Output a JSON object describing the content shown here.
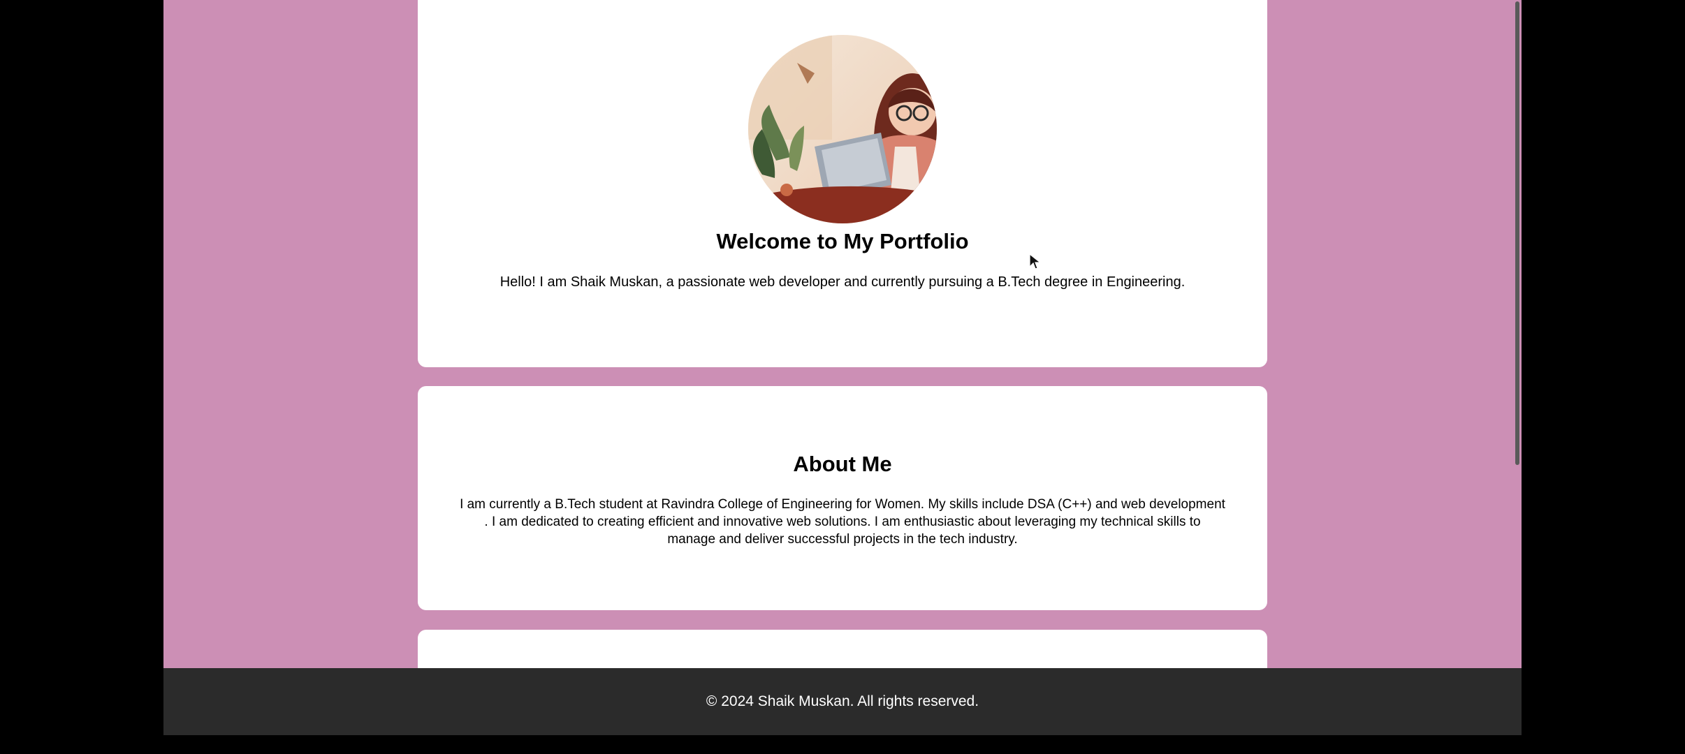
{
  "hero": {
    "title": "Welcome to My Portfolio",
    "intro": "Hello! I am Shaik Muskan, a passionate web developer and currently pursuing a B.Tech degree in Engineering.",
    "avatar_icon": "avatar-illustration"
  },
  "about": {
    "title": "About Me",
    "text": "I am currently a B.Tech student at Ravindra College of Engineering for Women. My skills include DSA (C++) and web development . I am dedicated to creating efficient and innovative web solutions. I am enthusiastic about leveraging my technical skills to manage and deliver successful projects in the tech industry."
  },
  "footer": {
    "text": "© 2024 Shaik Muskan. All rights reserved."
  },
  "colors": {
    "page_background": "#cc8fb5",
    "card_background": "#ffffff",
    "footer_background": "#2b2b2b",
    "outer_background": "#000000"
  }
}
